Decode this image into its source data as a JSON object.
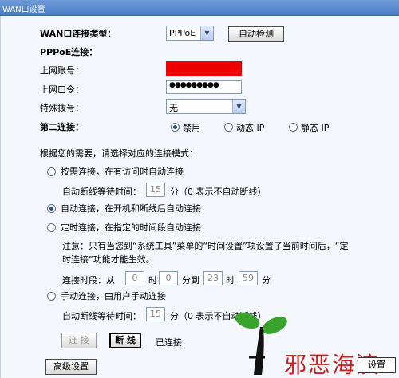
{
  "window": {
    "title": "WAN口设置"
  },
  "wan": {
    "type_label": "WAN口连接类型：",
    "type_value": "PPPoE",
    "auto_detect_button": "自动检测"
  },
  "pppoe": {
    "section_title": "PPPoE连接：",
    "account_label": "上网账号：",
    "password_label": "上网口令：",
    "password_value": "●●●●●●●●●",
    "special_dial_label": "特殊拨号：",
    "special_dial_value": "无"
  },
  "second": {
    "label": "第二连接：",
    "options": [
      "禁用",
      "动态 IP",
      "静态 IP"
    ],
    "selected": "禁用"
  },
  "mode": {
    "intro": "根据您的需要，请选择对应的连接模式：",
    "on_demand": "按需连接，在有访问时自动连接",
    "idle_label_1": "自动断线等待时间：",
    "idle_value_1": "15",
    "idle_unit_1": "分（0 表示不自动断线）",
    "auto": "自动连接，在开机和断线后自动连接",
    "timed": "定时连接，在指定的时间段自动连接",
    "note_line1": "注意：只有当您到“系统工具”菜单的“时间设置”项设置了当前时间后，“定",
    "note_line2": "时连接”功能才能生效。",
    "period_label": "连接时段：从",
    "from_hour": "0",
    "hour_text": "时",
    "from_min": "0",
    "to_text": "分到",
    "to_hour": "23",
    "to_min": "59",
    "min_text": "分",
    "manual": "手动连接，由用户手动连接",
    "idle_label_2": "自动断线等待时间：",
    "idle_value_2": "15",
    "idle_unit_2": "分（0 表示不自动断线）",
    "selected": "auto"
  },
  "actions": {
    "connect_button": "连 接",
    "disconnect_button": "断 线",
    "status": "已连接",
    "advanced_button": "高级设置"
  },
  "watermark": {
    "text": "邪恶海滨",
    "stamp": "设置"
  },
  "colors": {
    "redacted": "#ee0000",
    "watermark": "#cc1f1f"
  }
}
